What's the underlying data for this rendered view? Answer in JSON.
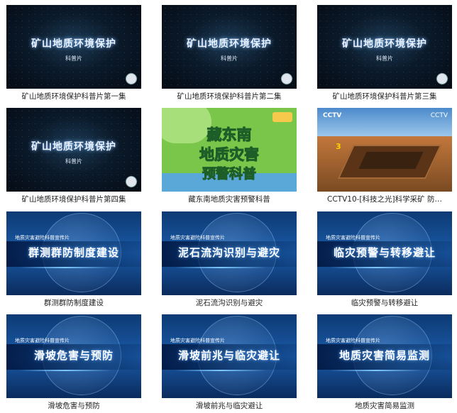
{
  "videos": [
    {
      "caption": "矿山地质环境保护科普片第一集",
      "title": "矿山地质环境保护",
      "subtitle": "科普片"
    },
    {
      "caption": "矿山地质环境保护科普片第二集",
      "title": "矿山地质环境保护",
      "subtitle": "科普片"
    },
    {
      "caption": "矿山地质环境保护科普片第三集",
      "title": "矿山地质环境保护",
      "subtitle": "科普片"
    },
    {
      "caption": "矿山地质环境保护科普片第四集",
      "title": "矿山地质环境保护",
      "subtitle": "科普片"
    },
    {
      "caption": "藏东南地质灾害预警科普",
      "line1": "藏东南",
      "line2": "地质灾害",
      "line3": "预警科普"
    },
    {
      "caption": "CCTV10-[科技之光]科学采矿 防…",
      "logo": "CCTV",
      "logo2": "CCTV",
      "number": "3"
    },
    {
      "caption": "群测群防制度建设",
      "series": "地质灾害避险科普宣传片",
      "title": "群测群防制度建设"
    },
    {
      "caption": "泥石流沟识别与避灾",
      "series": "地质灾害避险科普宣传片",
      "title": "泥石流沟识别与避灾"
    },
    {
      "caption": "临灾预警与转移避让",
      "series": "地质灾害避险科普宣传片",
      "title": "临灾预警与转移避让"
    },
    {
      "caption": "滑坡危害与预防",
      "series": "地质灾害避险科普宣传片",
      "title": "滑坡危害与预防"
    },
    {
      "caption": "滑坡前兆与临灾避让",
      "series": "地质灾害避险科普宣传片",
      "title": "滑坡前兆与临灾避让"
    },
    {
      "caption": "地质灾害简易监测",
      "series": "地质灾害避险科普宣传片",
      "title": "地质灾害简易监测"
    }
  ]
}
